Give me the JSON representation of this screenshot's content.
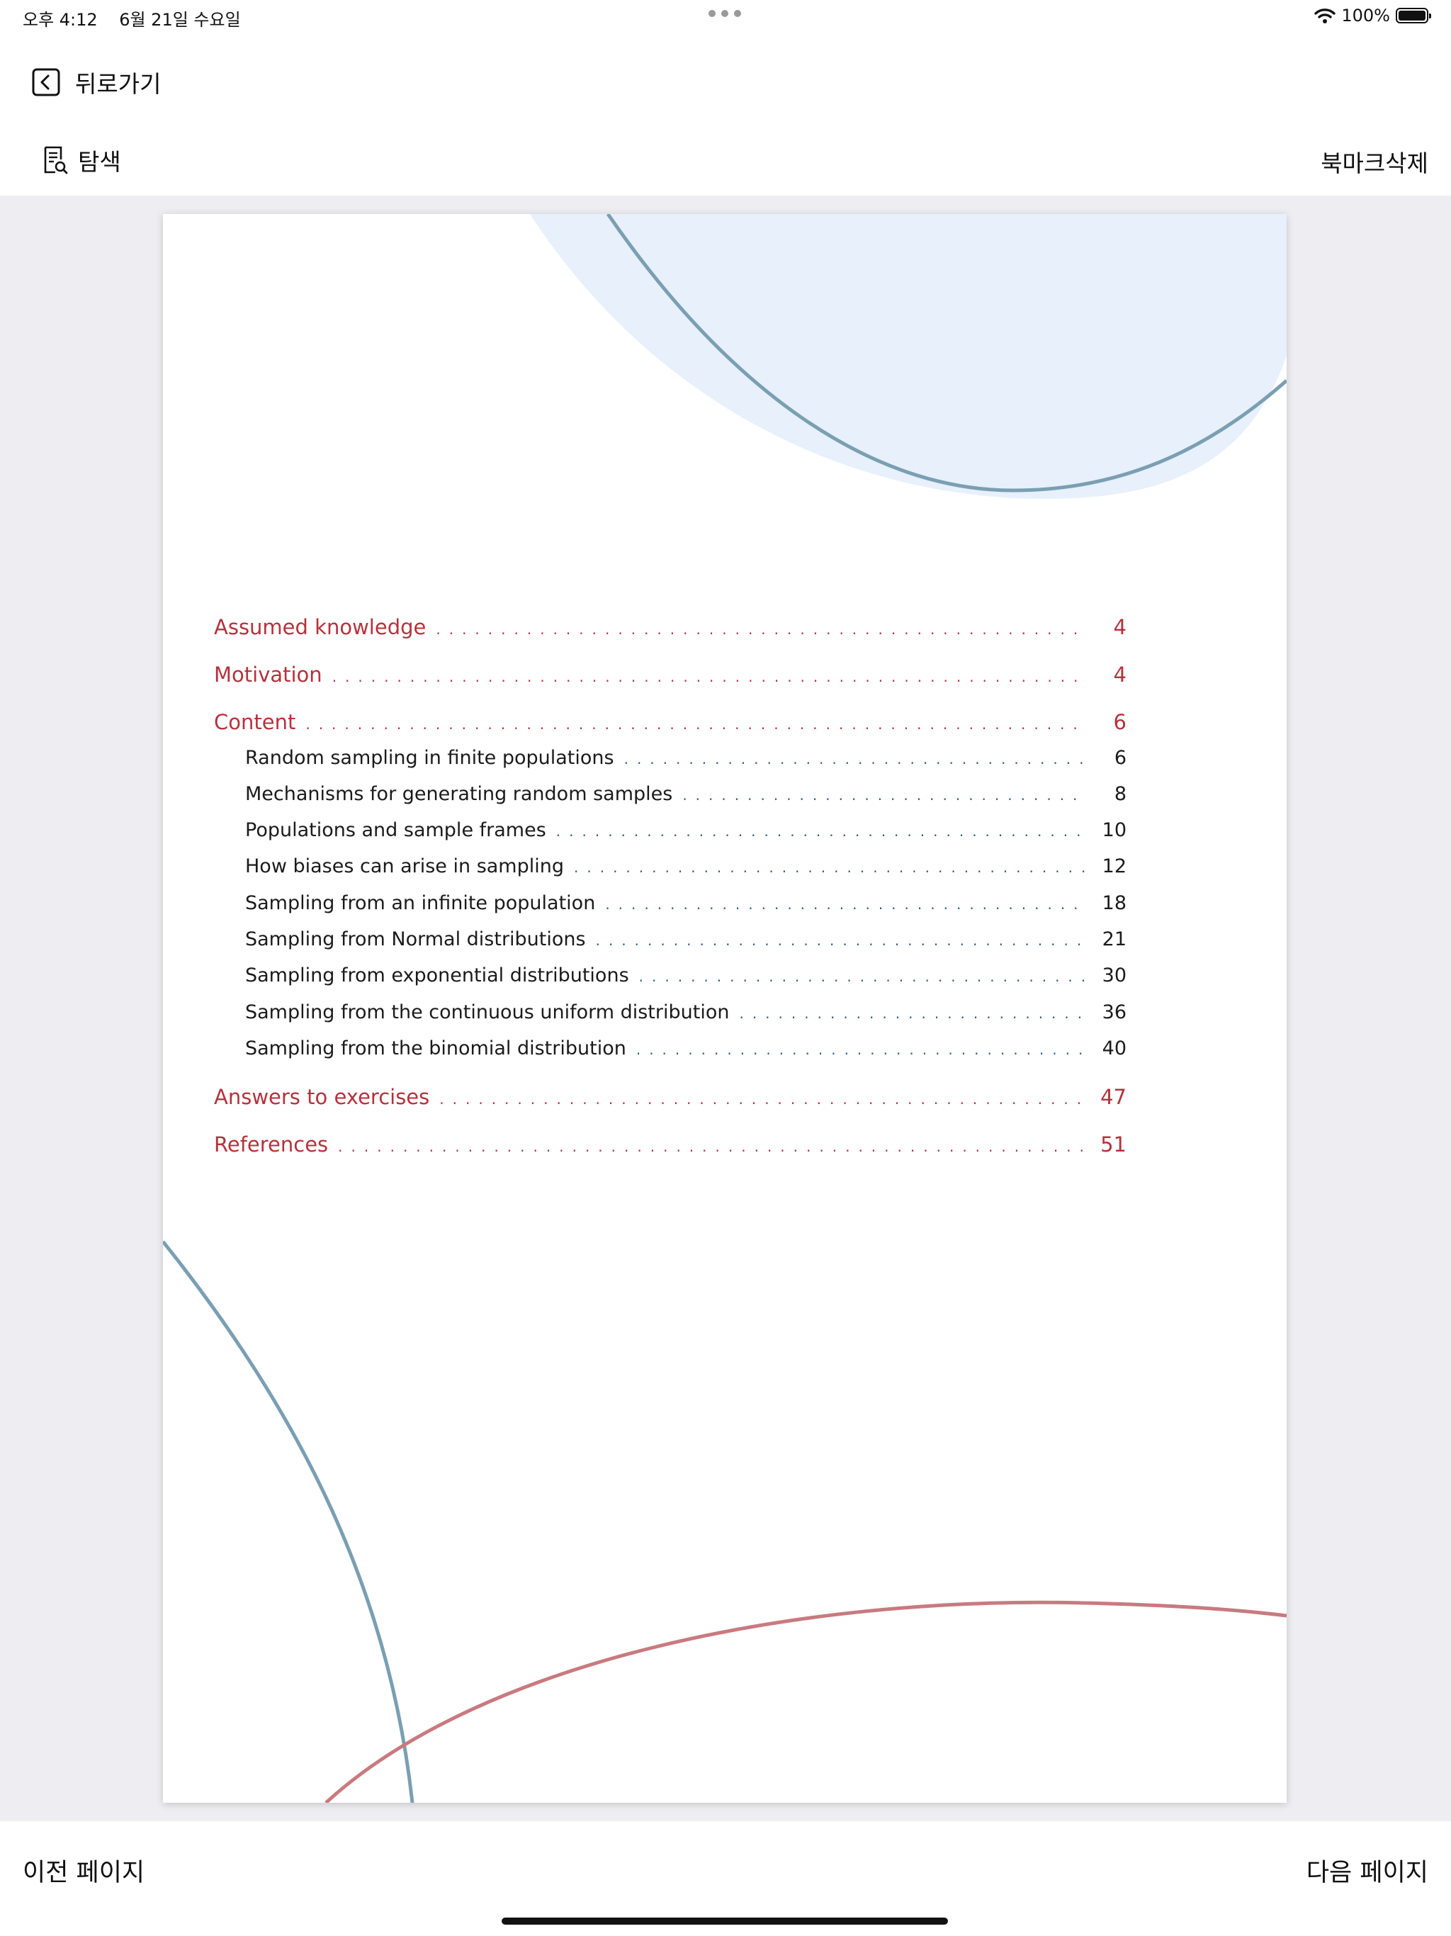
{
  "status_bar": {
    "time": "오후 4:12",
    "date": "6월 21일 수요일",
    "battery": "100%",
    "wifi_icon": "wifi-icon",
    "battery_icon": "battery-icon"
  },
  "nav": {
    "back_label": "뒤로가기",
    "back_icon": "back-chevron-icon"
  },
  "toolbar": {
    "search_label": "탐색",
    "search_icon": "document-search-icon",
    "bookmark_delete_label": "북마크삭제"
  },
  "colors": {
    "major_entry": "#b5323c",
    "minor_entry": "#1b1b1b",
    "leader_minor": "#2f5f8a",
    "arc_blue": "#7a9fb3",
    "arc_red": "#c97a7f",
    "blob_fill": "#e7f0fb",
    "viewer_bg": "#eeeef2"
  },
  "toc": [
    {
      "title": "Assumed knowledge",
      "page": "4",
      "level": "major"
    },
    {
      "title": "Motivation",
      "page": "4",
      "level": "major"
    },
    {
      "title": "Content",
      "page": "6",
      "level": "major"
    },
    {
      "title": "Random sampling in finite populations",
      "page": "6",
      "level": "minor"
    },
    {
      "title": "Mechanisms for generating random samples",
      "page": "8",
      "level": "minor"
    },
    {
      "title": "Populations and sample frames",
      "page": "10",
      "level": "minor"
    },
    {
      "title": "How biases can arise in sampling",
      "page": "12",
      "level": "minor"
    },
    {
      "title": "Sampling from an infinite population",
      "page": "18",
      "level": "minor"
    },
    {
      "title": "Sampling from Normal distributions",
      "page": "21",
      "level": "minor"
    },
    {
      "title": "Sampling from exponential distributions",
      "page": "30",
      "level": "minor"
    },
    {
      "title": "Sampling from the continuous uniform distribution",
      "page": "36",
      "level": "minor"
    },
    {
      "title": "Sampling from the binomial distribution",
      "page": "40",
      "level": "minor"
    },
    {
      "title": "Answers to exercises",
      "page": "47",
      "level": "major"
    },
    {
      "title": "References",
      "page": "51",
      "level": "major"
    }
  ],
  "bottom": {
    "prev_label": "이전 페이지",
    "next_label": "다음 페이지"
  }
}
